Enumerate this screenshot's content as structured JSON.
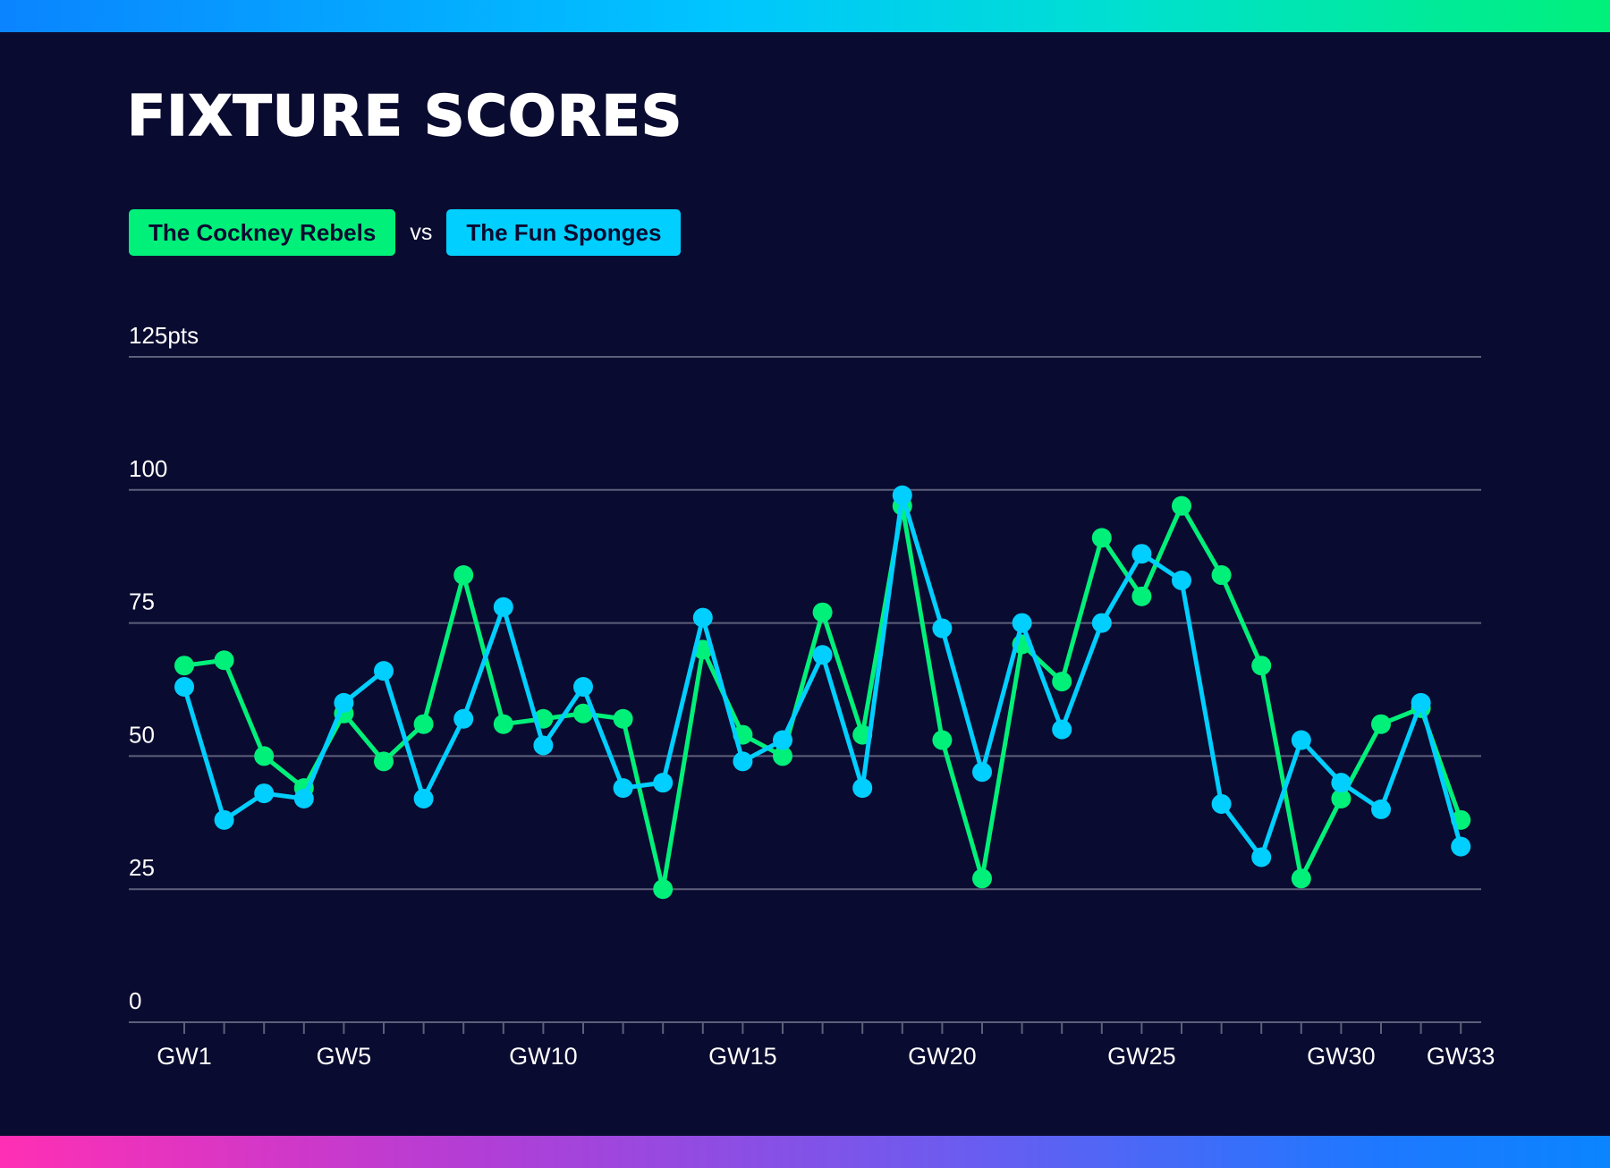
{
  "title": "FIXTURE SCORES",
  "legend": {
    "team_a": "The Cockney Rebels",
    "vs": "vs",
    "team_b": "The Fun Sponges"
  },
  "colors": {
    "background": "#0a0b30",
    "team_a": "#00f07a",
    "team_b": "#00cfff",
    "grid": "#5c607a"
  },
  "chart_data": {
    "type": "line",
    "title": "FIXTURE SCORES",
    "ylim": [
      0,
      125
    ],
    "y_ticks": [
      {
        "value": 125,
        "label": "125pts"
      },
      {
        "value": 100,
        "label": "100"
      },
      {
        "value": 75,
        "label": "75"
      },
      {
        "value": 50,
        "label": "50"
      },
      {
        "value": 25,
        "label": "25"
      },
      {
        "value": 0,
        "label": "0"
      }
    ],
    "x": [
      "GW1",
      "GW2",
      "GW3",
      "GW4",
      "GW5",
      "GW6",
      "GW7",
      "GW8",
      "GW9",
      "GW10",
      "GW11",
      "GW12",
      "GW13",
      "GW14",
      "GW15",
      "GW16",
      "GW17",
      "GW18",
      "GW19",
      "GW20",
      "GW21",
      "GW22",
      "GW23",
      "GW24",
      "GW25",
      "GW26",
      "GW27",
      "GW28",
      "GW29",
      "GW30",
      "GW31",
      "GW32",
      "GW33"
    ],
    "x_tick_labels": [
      {
        "gw": 1,
        "label": "GW1"
      },
      {
        "gw": 5,
        "label": "GW5"
      },
      {
        "gw": 10,
        "label": "GW10"
      },
      {
        "gw": 15,
        "label": "GW15"
      },
      {
        "gw": 20,
        "label": "GW20"
      },
      {
        "gw": 25,
        "label": "GW25"
      },
      {
        "gw": 30,
        "label": "GW30"
      },
      {
        "gw": 33,
        "label": "GW33"
      }
    ],
    "grid": true,
    "legend_position": "top-left",
    "series": [
      {
        "name": "The Cockney Rebels",
        "color": "#00f07a",
        "values": [
          67,
          68,
          50,
          44,
          58,
          49,
          56,
          84,
          56,
          57,
          58,
          57,
          25,
          70,
          54,
          50,
          77,
          54,
          97,
          53,
          27,
          71,
          64,
          91,
          80,
          97,
          84,
          67,
          27,
          42,
          56,
          59,
          38
        ]
      },
      {
        "name": "The Fun Sponges",
        "color": "#00cfff",
        "values": [
          63,
          38,
          43,
          42,
          60,
          66,
          42,
          57,
          78,
          52,
          63,
          44,
          45,
          76,
          49,
          53,
          69,
          44,
          99,
          74,
          47,
          75,
          55,
          75,
          88,
          83,
          41,
          31,
          53,
          45,
          40,
          60,
          33
        ]
      }
    ]
  }
}
